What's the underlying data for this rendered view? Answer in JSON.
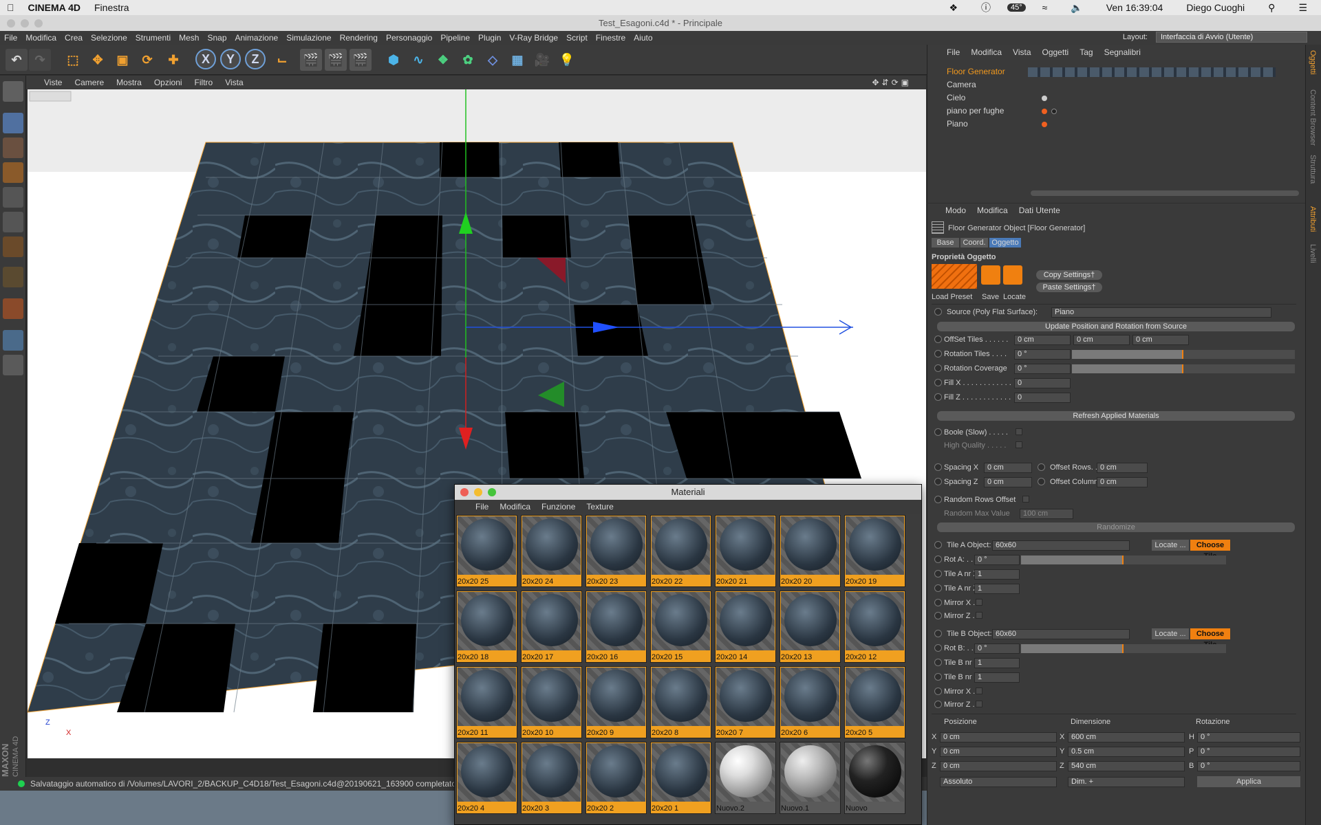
{
  "mac_menubar": {
    "apple": "",
    "app": "CINEMA 4D",
    "menu": "Finestra",
    "temp": "45°",
    "clock": "Ven 16:39:04",
    "user": "Diego Cuoghi"
  },
  "window_title": "Test_Esagoni.c4d * - Principale",
  "app_menu": [
    "File",
    "Modifica",
    "Crea",
    "Selezione",
    "Strumenti",
    "Mesh",
    "Snap",
    "Animazione",
    "Simulazione",
    "Rendering",
    "Personaggio",
    "Pipeline",
    "Plugin",
    "V-Ray Bridge",
    "Script",
    "Finestre",
    "Aiuto"
  ],
  "layout": {
    "label": "Layout:",
    "value": "Interfaccia di Avvio (Utente)"
  },
  "toolbar": {
    "x": "X",
    "y": "Y",
    "z": "Z"
  },
  "viewport_menu": [
    "Viste",
    "Camere",
    "Mostra",
    "Opzioni",
    "Filtro",
    "Vista"
  ],
  "viewport": {
    "axis_z": "Z",
    "axis_x": "X",
    "brand1": "MAXON",
    "brand2": "CINEMA 4D"
  },
  "status": "Salvataggio automatico di /Volumes/LAVORI_2/BACKUP_C4D18/Test_Esagoni.c4d@20190621_163900 completato",
  "materials": {
    "title": "Materiali",
    "menu": [
      "File",
      "Modifica",
      "Funzione",
      "Texture"
    ],
    "items": [
      "20x20 25",
      "20x20 24",
      "20x20 23",
      "20x20 22",
      "20x20 21",
      "20x20 20",
      "20x20 19",
      "20x20 18",
      "20x20 17",
      "20x20 16",
      "20x20 15",
      "20x20 14",
      "20x20 13",
      "20x20 12",
      "20x20 11",
      "20x20 10",
      "20x20 9",
      "20x20 8",
      "20x20 7",
      "20x20 6",
      "20x20 5",
      "20x20 4",
      "20x20 3",
      "20x20 2",
      "20x20 1",
      "Nuovo.2",
      "Nuovo.1",
      "Nuovo"
    ]
  },
  "object_manager": {
    "menu": [
      "File",
      "Modifica",
      "Vista",
      "Oggetti",
      "Tag",
      "Segnalibri"
    ],
    "objects": [
      "Floor Generator",
      "Camera",
      "Cielo",
      "piano per fughe",
      "Piano"
    ]
  },
  "right_tabs": [
    "Oggetti",
    "Content Browser",
    "Struttura",
    "Attributi",
    "Livelli"
  ],
  "attributes": {
    "menu": [
      "Modo",
      "Modifica",
      "Dati Utente"
    ],
    "header": "Floor Generator Object [Floor Generator]",
    "tabs": [
      "Base",
      "Coord.",
      "Oggetto"
    ],
    "section": "Proprietà Oggetto",
    "load_preset": "Load Preset",
    "save": "Save",
    "locate": "Locate",
    "copy_settings": "Copy Settings†",
    "paste_settings": "Paste Settings†",
    "source_label": "Source (Poly Flat Surface):",
    "source_value": "Piano",
    "update_btn": "Update Position and Rotation from Source",
    "offset_tiles": "OffSet Tiles . . . . . .",
    "offset_values": [
      "0 cm",
      "0 cm",
      "0 cm"
    ],
    "rotation_tiles": "Rotation Tiles . . . .",
    "rotation_tiles_value": "0 °",
    "rotation_coverage": "Rotation Coverage",
    "rotation_coverage_value": "0 °",
    "rotation_tiles_fill": 0.5,
    "rotation_coverage_fill": 0.5,
    "fill_x": "Fill X . . . . . . . . . . . .",
    "fill_x_value": "0",
    "fill_z": "Fill Z . . . . . . . . . . . .",
    "fill_z_value": "0",
    "refresh_btn": "Refresh Applied Materials",
    "boole": "Boole (Slow) . . . . .",
    "high_quality": "High Quality . . . . .",
    "spacing_x": "Spacing X",
    "spacing_x_value": "0 cm",
    "spacing_z": "Spacing Z",
    "spacing_z_value": "0 cm",
    "offset_rows": "Offset Rows. . .",
    "offset_rows_value": "0 cm",
    "offset_columns": "Offset Columns",
    "offset_columns_value": "0 cm",
    "random_rows": "Random Rows Offset",
    "random_max": "Random Max Value",
    "random_max_value": "100 cm",
    "randomize": "Randomize",
    "tile_a": "Tile A Object:",
    "tile_a_value": "60x60",
    "locate_btn": "Locate ...",
    "choose_tile": "Choose Tile",
    "rot_a": "Rot A: . . . .",
    "rot_a_value": "0 °",
    "rot_a_fill": 0.5,
    "tile_a_nr_x": "Tile A nr X",
    "tile_a_nr_x_value": "1",
    "tile_a_nr_z": "Tile A nr Z",
    "tile_a_nr_z_value": "1",
    "mirror_x": "Mirror X . .",
    "mirror_z": "Mirror Z . .",
    "tile_b": "Tile B Object:",
    "tile_b_value": "60x60",
    "rot_b": "Rot B: . . . .",
    "rot_b_value": "0 °",
    "rot_b_fill": 0.5,
    "tile_b_nr_x": "Tile B nr X",
    "tile_b_nr_x_value": "1",
    "tile_b_nr_z": "Tile B nr Z",
    "tile_b_nr_z_value": "1"
  },
  "coords": {
    "posizione": "Posizione",
    "dimensione": "Dimensione",
    "rotazione": "Rotazione",
    "px": "0 cm",
    "py": "0 cm",
    "pz": "0 cm",
    "dx": "600 cm",
    "dy": "0.5 cm",
    "dz": "540 cm",
    "rh": "0 °",
    "rp": "0 °",
    "rb": "0 °",
    "lx": "X",
    "ly": "Y",
    "lz": "Z",
    "lh": "H",
    "lp": "P",
    "lb": "B",
    "assoluto": "Assoluto",
    "dim": "Dim. +",
    "applica": "Applica"
  }
}
